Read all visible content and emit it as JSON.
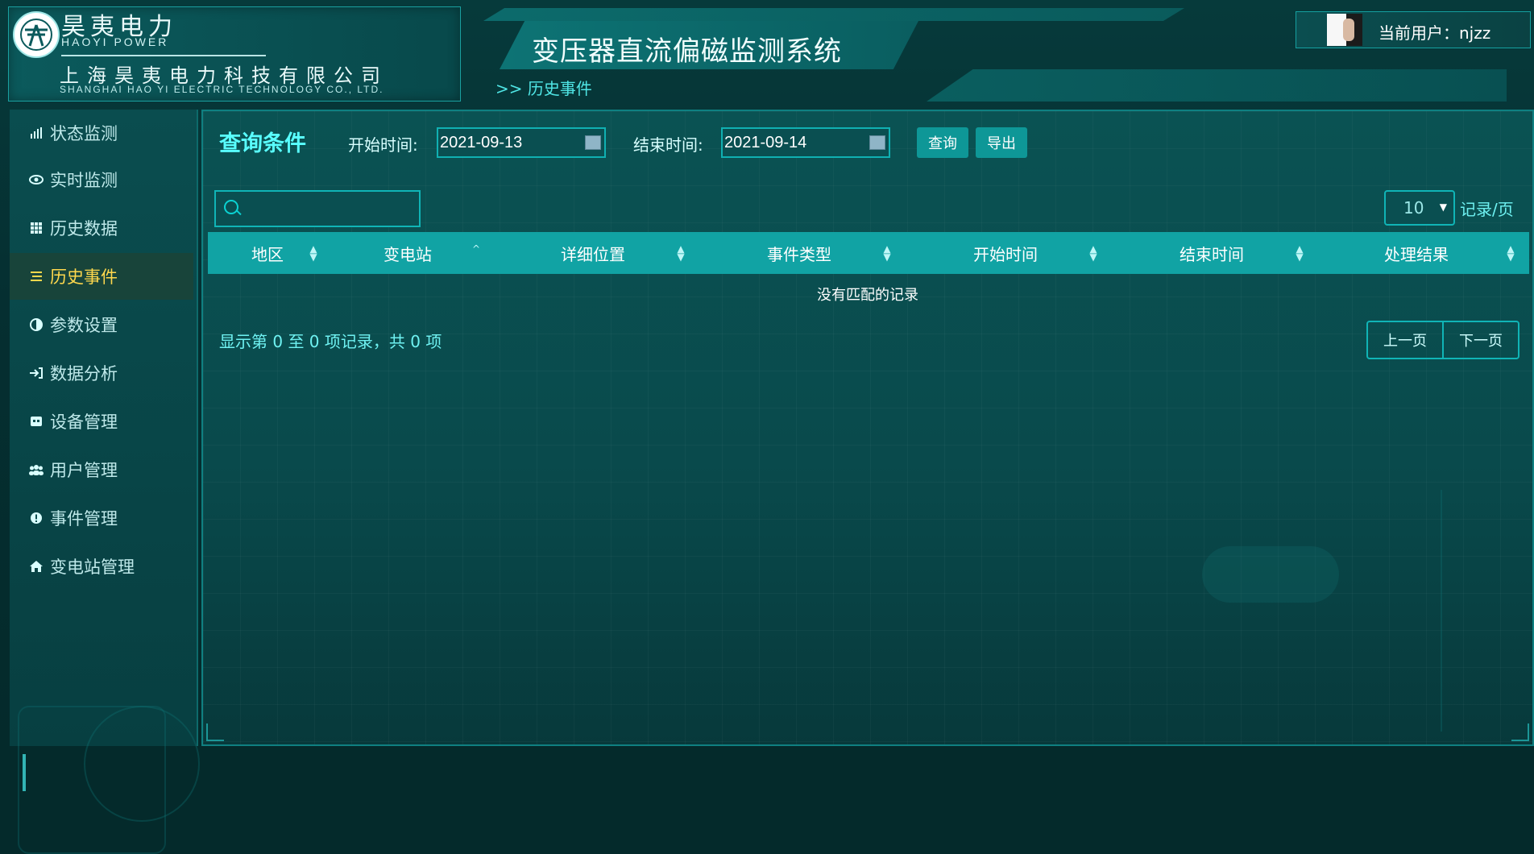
{
  "brand": {
    "name_cn": "昊夷电力",
    "name_en": "HAOYI POWER",
    "company_cn": "上海昊夷电力科技有限公司",
    "company_en": "SHANGHAI HAO YI ELECTRIC TECHNOLOGY CO., LTD."
  },
  "header": {
    "system_title": "变压器直流偏磁监测系统",
    "breadcrumb": ">> 历史事件",
    "user_label": "当前用户：njzz"
  },
  "sidebar": {
    "items": [
      {
        "label": "状态监测",
        "icon": "bar-chart-icon"
      },
      {
        "label": "实时监测",
        "icon": "eye-icon"
      },
      {
        "label": "历史数据",
        "icon": "grid-icon"
      },
      {
        "label": "历史事件",
        "icon": "list-icon",
        "active": true
      },
      {
        "label": "参数设置",
        "icon": "contrast-icon"
      },
      {
        "label": "数据分析",
        "icon": "sign-in-icon"
      },
      {
        "label": "设备管理",
        "icon": "device-icon"
      },
      {
        "label": "用户管理",
        "icon": "users-icon"
      },
      {
        "label": "事件管理",
        "icon": "alert-icon"
      },
      {
        "label": "变电站管理",
        "icon": "home-icon"
      }
    ]
  },
  "query": {
    "title": "查询条件",
    "start_label": "开始时间:",
    "start_value": "2021-09-13",
    "end_label": "结束时间:",
    "end_value": "2021-09-14",
    "query_button": "查询",
    "export_button": "导出"
  },
  "table": {
    "search_placeholder": "",
    "page_size": "10",
    "page_size_label": "记录/页",
    "columns": [
      "地区",
      "变电站",
      "详细位置",
      "事件类型",
      "开始时间",
      "结束时间",
      "处理结果"
    ],
    "empty_text": "没有匹配的记录",
    "info_text": "显示第 0 至 0 项记录，共 0 项",
    "prev": "上一页",
    "next": "下一页"
  },
  "colors": {
    "background": "#042a2b",
    "accent": "#11a3a4",
    "highlight_text": "#59ffff",
    "active_nav_text": "#ffd84d"
  }
}
